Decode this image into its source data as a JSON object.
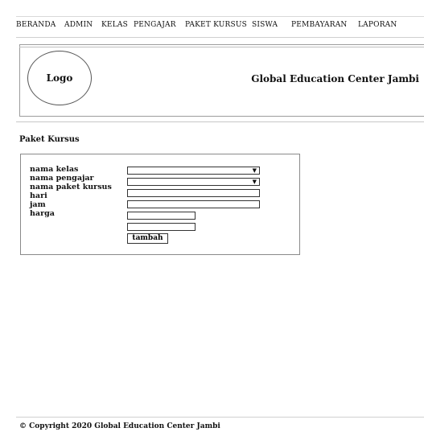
{
  "nav": {
    "items": [
      "BERANDA",
      "ADMIN",
      "KELAS",
      "PENGAJAR",
      "PAKET KURSUS",
      "SISWA",
      "PEMBAYARAN",
      "LAPORAN"
    ]
  },
  "header": {
    "logo_label": "Logo",
    "site_title": "Global Education Center Jambi"
  },
  "page": {
    "title": "Paket Kursus"
  },
  "form": {
    "labels": [
      "nama kelas",
      "nama pengajar",
      "nama paket kursus",
      "hari",
      "jam",
      "harga"
    ],
    "dropdown_icon": "triangle-down",
    "submit_label": "tambah"
  },
  "footer": {
    "text": "© Copyright 2020 Global Education Center Jambi"
  }
}
